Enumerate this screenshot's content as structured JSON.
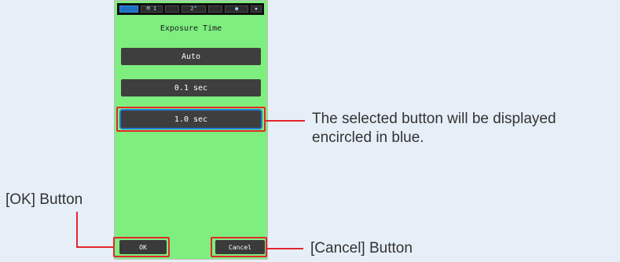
{
  "device": {
    "status_bar": {
      "mode_label": "M 1",
      "angle_label": "2°",
      "meter_label": "●",
      "end_label": "▪"
    },
    "title": "Exposure Time",
    "options": [
      {
        "label": "Auto",
        "selected": false
      },
      {
        "label": "0.1 sec",
        "selected": false
      },
      {
        "label": "1.0 sec",
        "selected": true
      }
    ],
    "ok_label": "OK",
    "cancel_label": "Cancel"
  },
  "annotations": {
    "selected_note_line1": "The selected button will be displayed",
    "selected_note_line2": "encircled in blue.",
    "ok_label": "[OK] Button",
    "cancel_label": "[Cancel] Button"
  },
  "colors": {
    "screen_bg": "#7eee7e",
    "annotation_red": "#e3262e",
    "selected_blue": "#1f7bd6",
    "button_dark": "#3e3e3e",
    "page_bg": "#e6eef7"
  }
}
